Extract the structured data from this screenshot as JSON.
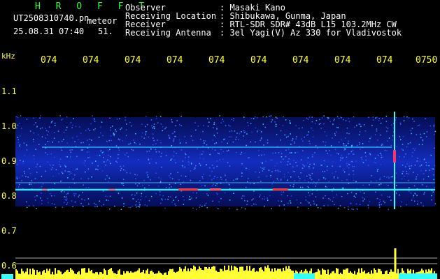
{
  "header": {
    "brand": "H R O F F T",
    "filename": "UT2508310740.pn",
    "mode": "meteor",
    "datetime": "25.08.31 07:40",
    "count": "51."
  },
  "info": {
    "labels": [
      "Observer",
      "Receiving Location",
      "Receiver",
      "Receiving Antenna"
    ],
    "values": [
      ": Masaki Kano",
      ": Shibukawa, Gunma, Japan",
      ": RTL-SDR SDR# 43dB L15 103.2MHz CW",
      ": 3el Yagi(V) Az 330 for Vladivostok"
    ]
  },
  "axis": {
    "unit": "kHz",
    "x_ticks": [
      "074",
      "074",
      "074",
      "074",
      "074",
      "074",
      "074",
      "074",
      "074",
      "0750"
    ],
    "y_ticks": [
      "1.1",
      "1.0",
      "0.9",
      "0.8",
      "0.7",
      "0.6"
    ]
  },
  "colors": {
    "background": "#000000",
    "header_green": "#33ff33",
    "label_white": "#ffffff",
    "tick_yellow": "#ffff33",
    "signal_blue": "#1e3cff",
    "signal_cyan": "#33ffff",
    "signal_red": "#ff3333"
  }
}
